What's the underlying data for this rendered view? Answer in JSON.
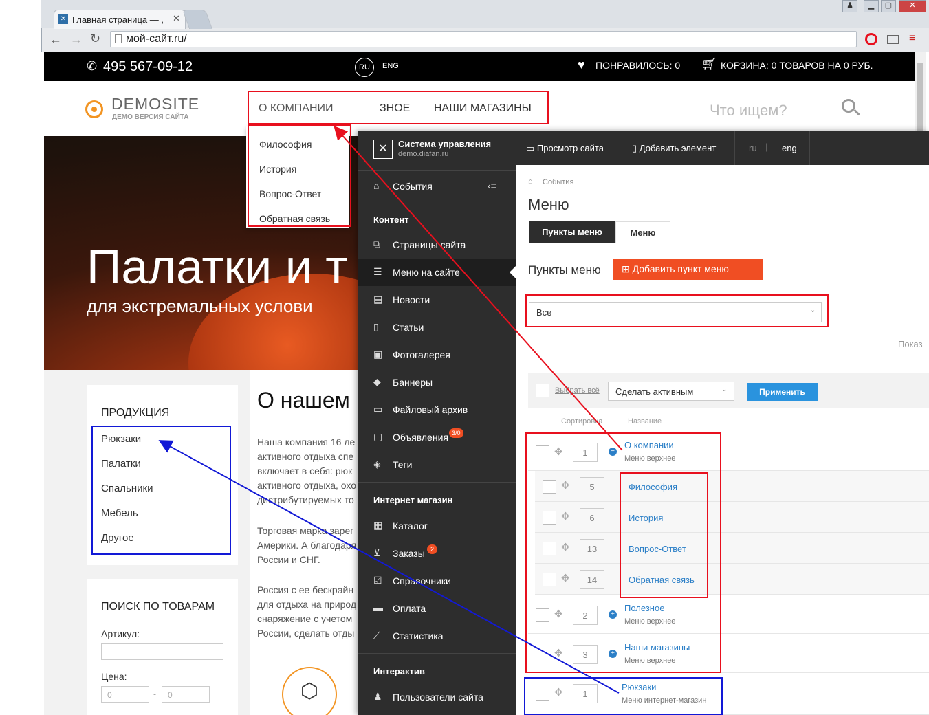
{
  "browser": {
    "tab_title": "Главная страница — ,",
    "url": "мой-сайт.ru/"
  },
  "site": {
    "phone": "495 567-09-12",
    "lang_ru": "RU",
    "lang_en": "ENG",
    "likes": "ПОНРАВИЛОСЬ: 0",
    "cart": "КОРЗИНА: 0 ТОВАРОВ НА 0 РУБ.",
    "logo_name": "DEMOSITE",
    "logo_sub": "ДЕМО ВЕРСИЯ САЙТА",
    "menu": {
      "about": "О КОМПАНИИ",
      "useful": "ЗНОЕ",
      "shops": "НАШИ МАГАЗИНЫ"
    },
    "dropdown": [
      "Философия",
      "История",
      "Вопрос-Ответ",
      "Обратная связь"
    ],
    "search_placeholder": "Что ищем?",
    "hero_title": "Палатки и т",
    "hero_sub": "для экстремальных услови",
    "products_title": "ПРОДУКЦИЯ",
    "products": [
      "Рюкзаки",
      "Палатки",
      "Спальники",
      "Мебель",
      "Другое"
    ],
    "search_title": "ПОИСК ПО ТОВАРАМ",
    "article_label": "Артикул:",
    "price_label": "Цена:",
    "price_from": "0",
    "price_dash": "-",
    "price_to": "0",
    "about_heading": "О нашем",
    "para1": [
      "Наша компания 16 ле",
      "активного отдыха спе",
      "включает в себя: рюк",
      "активного отдыха, охо",
      "дистрибутируемых то"
    ],
    "para2": [
      "Торговая марка зарег",
      "Америки. А благодаря",
      "России и СНГ."
    ],
    "para3": [
      "Россия с ее бескрайн",
      "для отдыха на природ",
      "снаряжение с учетом",
      "России, сделать отды"
    ]
  },
  "admin": {
    "brand_title": "Система управления",
    "brand_sub": "demo.diafan.ru",
    "top_view": "Просмотр сайта",
    "top_add": "Добавить элемент",
    "top_ru": "ru",
    "top_eng": "eng",
    "events": "События",
    "sec_content": "Контент",
    "nav_content": [
      "Страницы сайта",
      "Меню на сайте",
      "Новости",
      "Статьи",
      "Фотогалерея",
      "Баннеры",
      "Файловый архив",
      "Объявления",
      "Теги"
    ],
    "ads_badge": "3/0",
    "sec_shop": "Интернет магазин",
    "nav_shop": [
      "Каталог",
      "Заказы",
      "Справочники",
      "Оплата",
      "Статистика"
    ],
    "orders_badge": "2",
    "sec_inter": "Интерактив",
    "nav_inter": [
      "Пользователи сайта"
    ],
    "breadcrumb": "События",
    "page_title": "Меню",
    "tab_items": "Пункты меню",
    "tab_menu": "Меню",
    "section_label": "Пункты меню",
    "add_btn": "Добавить пункт меню",
    "filter_value": "Все",
    "show_label": "Показ",
    "select_all": "Выбрать всё",
    "action_value": "Сделать активным",
    "apply": "Применить",
    "col_sort": "Сортировка",
    "col_name": "Название",
    "rows": [
      {
        "num": "1",
        "name": "О компании",
        "sub": "Меню верхнее"
      },
      {
        "num": "5",
        "name": "Философия"
      },
      {
        "num": "6",
        "name": "История"
      },
      {
        "num": "13",
        "name": "Вопрос-Ответ"
      },
      {
        "num": "14",
        "name": "Обратная связь"
      },
      {
        "num": "2",
        "name": "Полезное",
        "sub": "Меню верхнее"
      },
      {
        "num": "3",
        "name": "Наши магазины",
        "sub": "Меню верхнее"
      },
      {
        "num": "1",
        "name": "Рюкзаки",
        "sub": "Меню интернет-магазин"
      }
    ]
  }
}
